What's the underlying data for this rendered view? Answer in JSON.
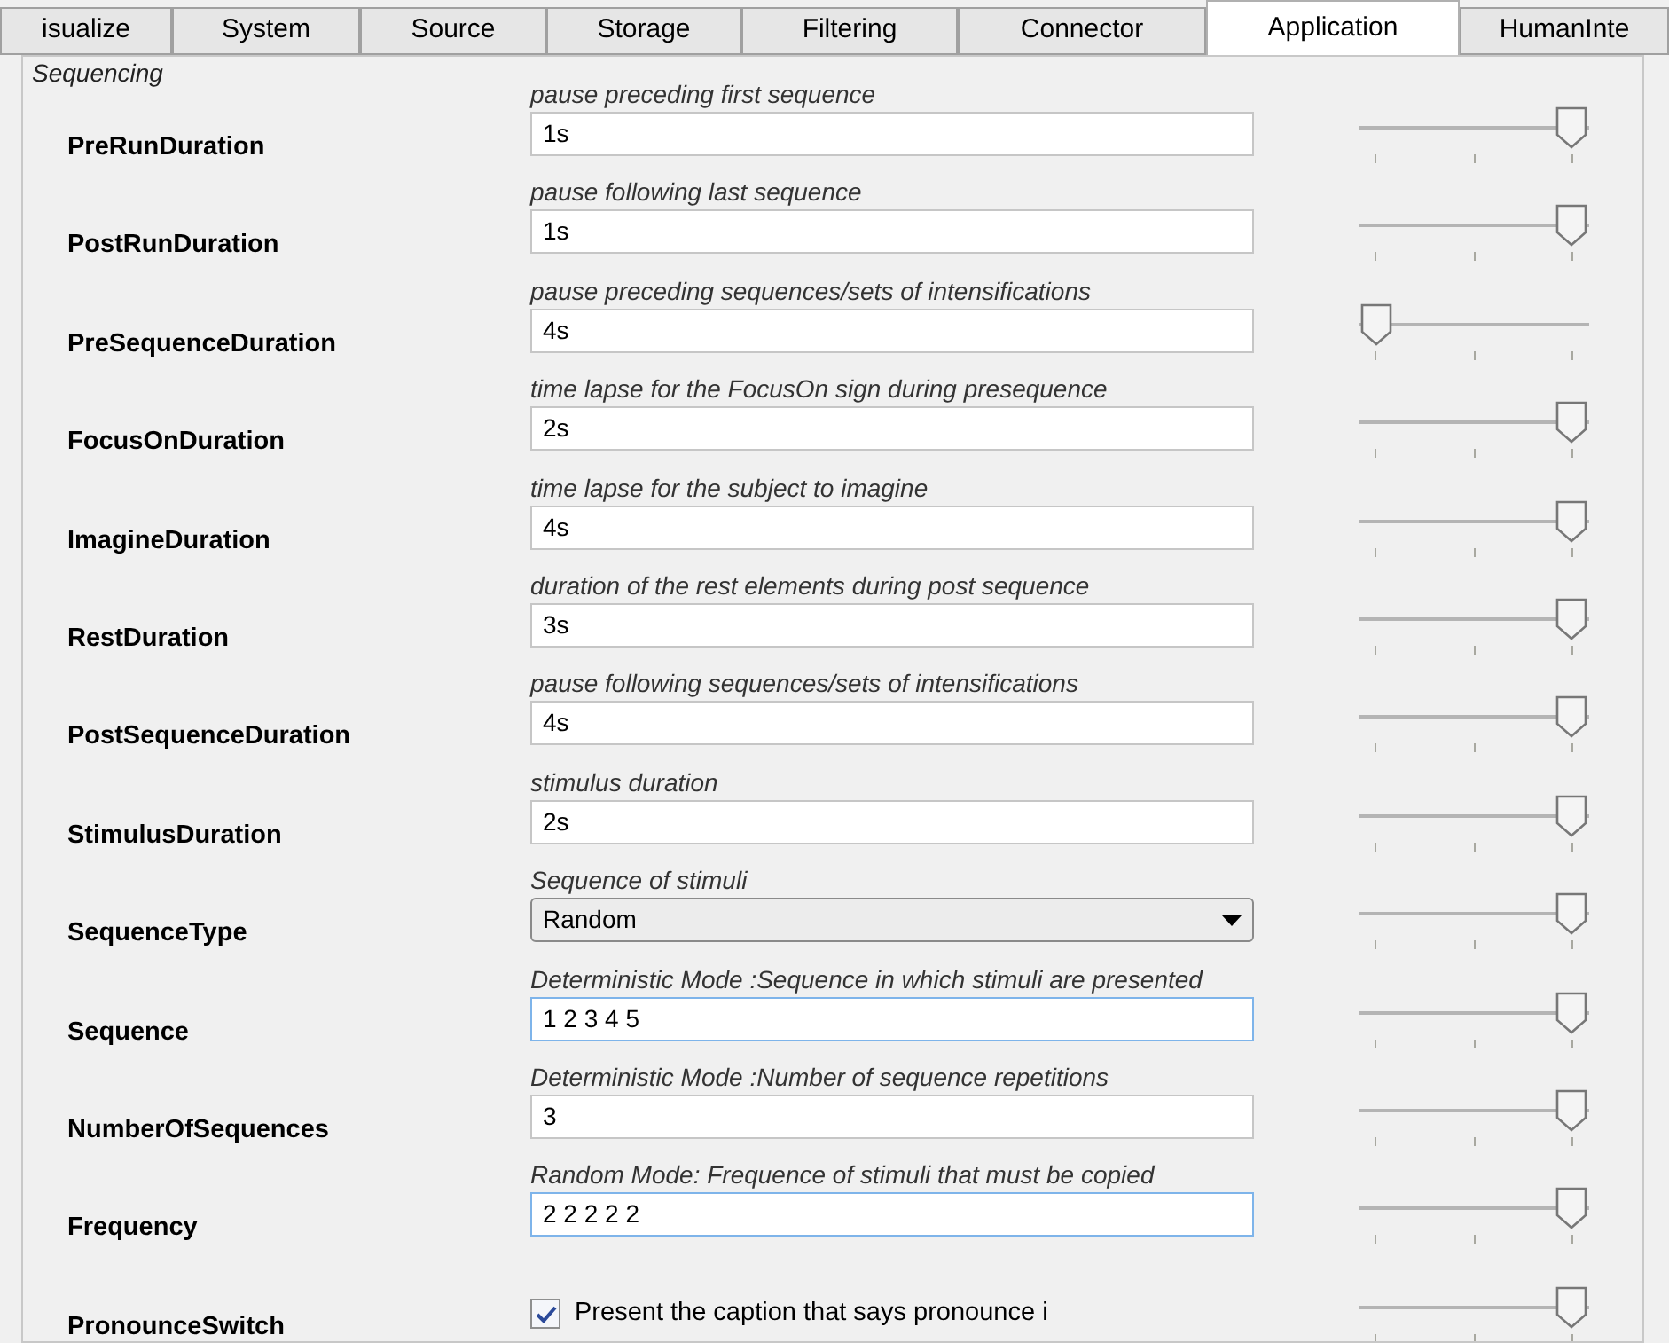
{
  "tabs": [
    {
      "label": "isualize",
      "selected": false
    },
    {
      "label": "System",
      "selected": false
    },
    {
      "label": "Source",
      "selected": false
    },
    {
      "label": "Storage",
      "selected": false
    },
    {
      "label": "Filtering",
      "selected": false
    },
    {
      "label": "Connector",
      "selected": false
    },
    {
      "label": "Application",
      "selected": true
    },
    {
      "label": "HumanInte",
      "selected": false
    }
  ],
  "group": {
    "title": "Sequencing",
    "rows": [
      {
        "kind": "text",
        "label": "PreRunDuration",
        "description": "pause preceding first sequence",
        "value": "1s",
        "focused": false,
        "level": 1
      },
      {
        "kind": "text",
        "label": "PostRunDuration",
        "description": "pause following last sequence",
        "value": "1s",
        "focused": false,
        "level": 1
      },
      {
        "kind": "text",
        "label": "PreSequenceDuration",
        "description": "pause preceding sequences/sets of intensifications",
        "value": "4s",
        "focused": false,
        "level": 0
      },
      {
        "kind": "text",
        "label": "FocusOnDuration",
        "description": "time lapse for the FocusOn sign during presequence",
        "value": "2s",
        "focused": false,
        "level": 1
      },
      {
        "kind": "text",
        "label": "ImagineDuration",
        "description": "time lapse for the subject to imagine",
        "value": "4s",
        "focused": false,
        "level": 1
      },
      {
        "kind": "text",
        "label": "RestDuration",
        "description": "duration of the rest elements during post sequence",
        "value": "3s",
        "focused": false,
        "level": 1
      },
      {
        "kind": "text",
        "label": "PostSequenceDuration",
        "description": "pause following sequences/sets of intensifications",
        "value": "4s",
        "focused": false,
        "level": 1
      },
      {
        "kind": "text",
        "label": "StimulusDuration",
        "description": "stimulus duration",
        "value": "2s",
        "focused": false,
        "level": 1
      },
      {
        "kind": "dropdown",
        "label": "SequenceType",
        "description": "Sequence of stimuli",
        "value": "Random",
        "level": 1
      },
      {
        "kind": "text",
        "label": "Sequence",
        "description": "Deterministic Mode :Sequence in which stimuli are presented",
        "value": "1 2 3 4 5",
        "focused": true,
        "level": 1
      },
      {
        "kind": "text",
        "label": "NumberOfSequences",
        "description": "Deterministic Mode :Number of sequence repetitions",
        "value": "3",
        "focused": false,
        "level": 1
      },
      {
        "kind": "text",
        "label": "Frequency",
        "description": "Random Mode: Frequence of stimuli that must be copied",
        "value": "2 2 2 2 2",
        "focused": true,
        "level": 1
      },
      {
        "kind": "checkbox",
        "label": "PronounceSwitch",
        "value": "Present the caption that says pronounce i",
        "checked": true,
        "level": 1
      }
    ]
  }
}
